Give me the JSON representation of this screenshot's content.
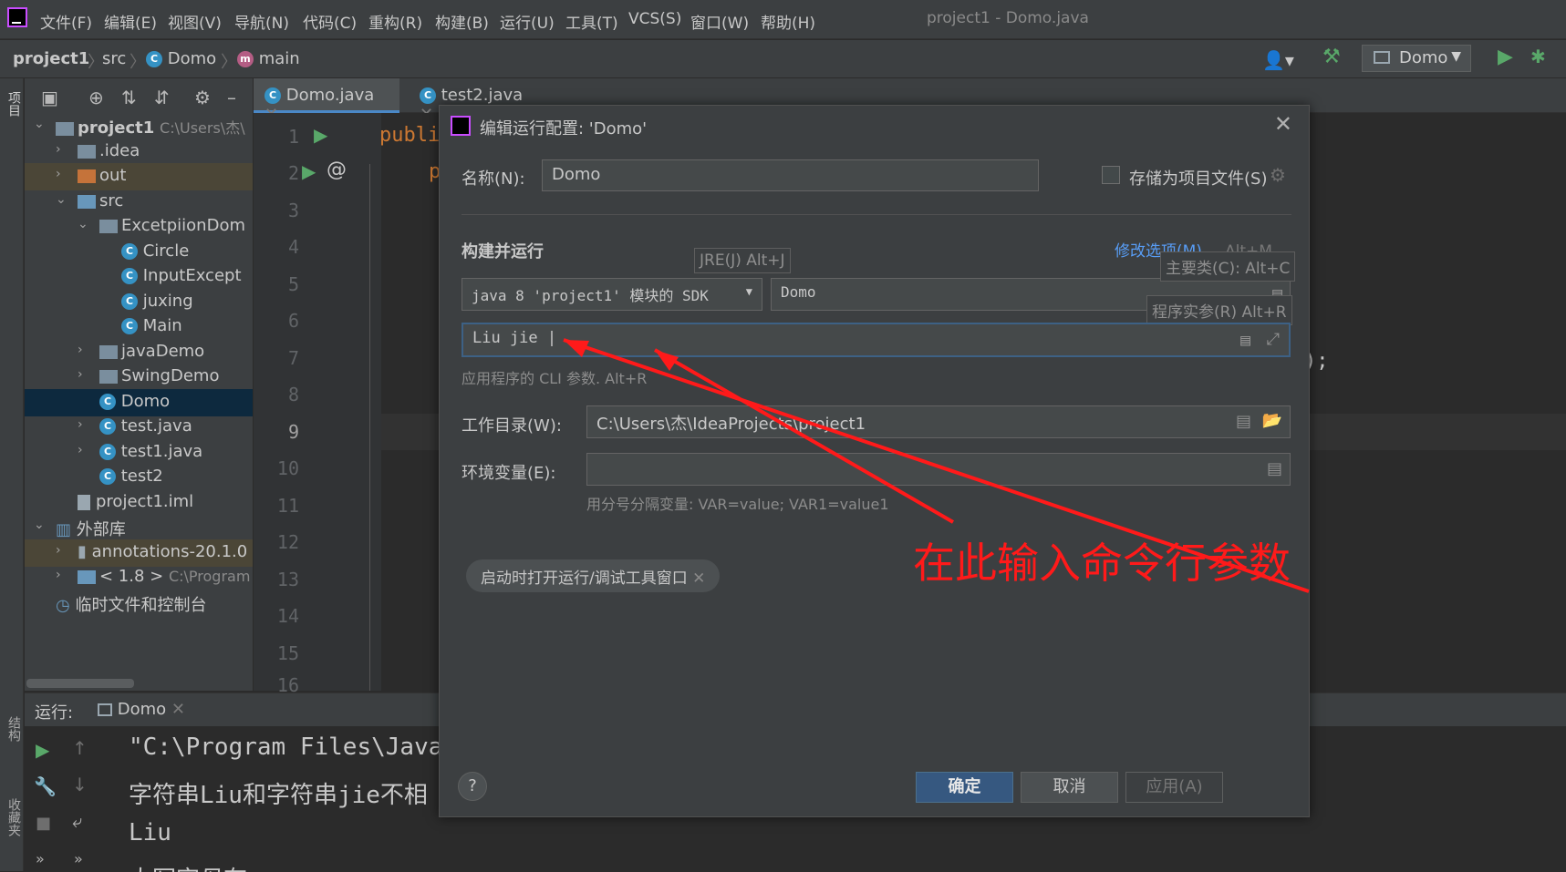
{
  "menubar": {
    "items": [
      "文件(F)",
      "编辑(E)",
      "视图(V)",
      "导航(N)",
      "代码(C)",
      "重构(R)",
      "构建(B)",
      "运行(U)",
      "工具(T)",
      "VCS(S)",
      "窗口(W)",
      "帮助(H)"
    ],
    "title": "project1 - Domo.java"
  },
  "navbar": {
    "project": "project1",
    "src": "src",
    "class": "Domo",
    "method": "main",
    "run_config": "Domo"
  },
  "sidebar": {
    "project_tab": "项目",
    "structure_tab": "结构",
    "favorites_tab": "收藏夹"
  },
  "tree": {
    "items": [
      {
        "label": "project1",
        "extra": "C:\\Users\\杰\\"
      },
      {
        "label": ".idea"
      },
      {
        "label": "out"
      },
      {
        "label": "src"
      },
      {
        "label": "ExcetpiionDom"
      },
      {
        "label": "Circle"
      },
      {
        "label": "InputExcept"
      },
      {
        "label": "juxing"
      },
      {
        "label": "Main"
      },
      {
        "label": "javaDemo"
      },
      {
        "label": "SwingDemo"
      },
      {
        "label": "Domo"
      },
      {
        "label": "test.java"
      },
      {
        "label": "test1.java"
      },
      {
        "label": "test2"
      },
      {
        "label": "project1.iml"
      },
      {
        "label": "外部库"
      },
      {
        "label": "annotations-20.1.0"
      },
      {
        "label": "< 1.8 >",
        "extra": "C:\\Program"
      },
      {
        "label": "临时文件和控制台"
      }
    ]
  },
  "editor": {
    "tabs": [
      "Domo.java",
      "test2.java"
    ],
    "line_numbers": [
      "1",
      "2",
      "3",
      "4",
      "5",
      "6",
      "7",
      "8",
      "9",
      "10",
      "11",
      "12",
      "13",
      "14",
      "15",
      "16"
    ],
    "code_line1": "publi",
    "code_line2": "p",
    "code_right": ");"
  },
  "run_panel": {
    "label": "运行:",
    "tab": "Domo",
    "lines": [
      "\"C:\\Program Files\\Java",
      "字符串Liu和字符串jie不相",
      "Liu",
      "大写字母有"
    ]
  },
  "dialog": {
    "title": "编辑运行配置: 'Domo'",
    "name_label": "名称(N):",
    "name_value": "Domo",
    "store_label": "存储为项目文件(S)",
    "section_title": "构建并运行",
    "modify_options": "修改选项(M)",
    "modify_shortcut": "Alt+M",
    "jre_tooltip": "JRE(J) Alt+J",
    "main_class_tooltip": "主要类(C): Alt+C",
    "args_tooltip": "程序实参(R) Alt+R",
    "jdk_value": "java 8 'project1' 模块的 SDK",
    "main_class_value": "Domo",
    "args_value": "Liu jie",
    "args_hint": "应用程序的 CLI 参数. Alt+R",
    "workdir_label": "工作目录(W):",
    "workdir_value": "C:\\Users\\杰\\IdeaProjects\\project1",
    "env_label": "环境变量(E):",
    "env_value": "",
    "env_hint": "用分号分隔变量: VAR=value; VAR1=value1",
    "chip_label": "启动时打开运行/调试工具窗口",
    "help": "?",
    "ok": "确定",
    "cancel": "取消",
    "apply": "应用(A)"
  },
  "annotation": {
    "text": "在此输入命令行参数",
    "color": "#ff1a1a"
  }
}
